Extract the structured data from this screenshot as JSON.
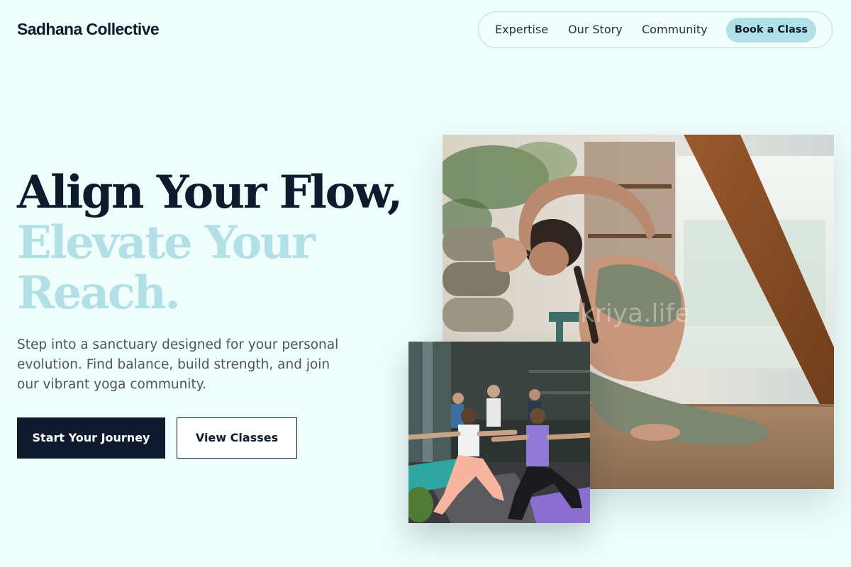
{
  "brand": {
    "name": "Sadhana Collective"
  },
  "nav": {
    "links": [
      "Expertise",
      "Our Story",
      "Community"
    ],
    "cta_label": "Book a Class"
  },
  "hero": {
    "headline_line1": "Align Your Flow,",
    "headline_line2": "Elevate Your",
    "headline_line3": "Reach.",
    "subtitle": "Step into a sanctuary designed for your personal evolution. Find balance, build strength, and join our vibrant yoga community.",
    "primary_cta": "Start Your Journey",
    "secondary_cta": "View Classes"
  },
  "images": {
    "main_watermark": "kriya.life"
  },
  "colors": {
    "background": "#effdfb",
    "navy": "#0f1a2e",
    "accent_light_teal": "#b1e0e7",
    "body_text": "#4a5563"
  }
}
